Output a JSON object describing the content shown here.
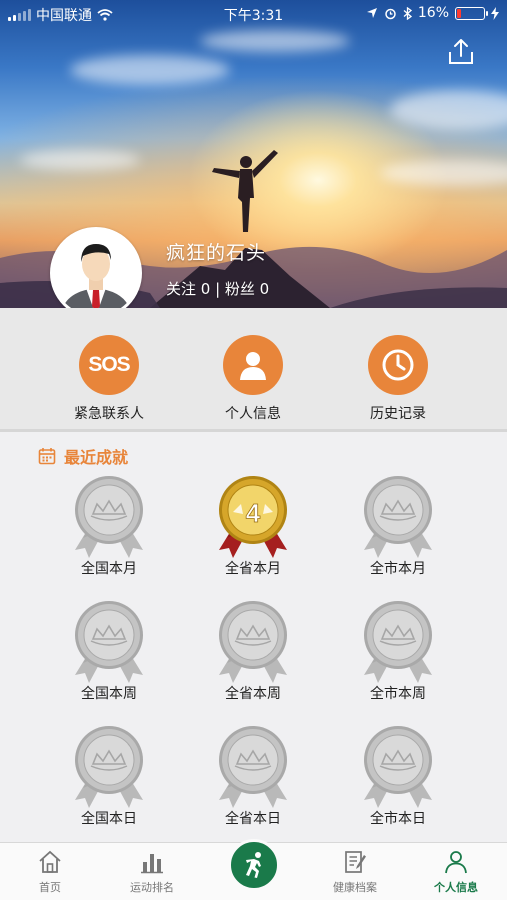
{
  "status_bar": {
    "carrier": "中国联通",
    "time": "下午3:31",
    "battery": "16%",
    "battery_level": 0.16
  },
  "profile": {
    "username": "疯狂的石头",
    "stats": "关注 0 | 粉丝 0"
  },
  "actions": [
    {
      "label": "紧急联系人",
      "icon": "sos-icon",
      "badge": "SOS"
    },
    {
      "label": "个人信息",
      "icon": "person-icon"
    },
    {
      "label": "历史记录",
      "icon": "clock-icon"
    }
  ],
  "achievements": {
    "title": "最近成就",
    "medals": [
      {
        "label": "全国本月",
        "kind": "silver"
      },
      {
        "label": "全省本月",
        "kind": "gold",
        "number": "4"
      },
      {
        "label": "全市本月",
        "kind": "silver"
      },
      {
        "label": "全国本周",
        "kind": "silver"
      },
      {
        "label": "全省本周",
        "kind": "silver"
      },
      {
        "label": "全市本周",
        "kind": "silver"
      },
      {
        "label": "全国本日",
        "kind": "silver"
      },
      {
        "label": "全省本日",
        "kind": "silver"
      },
      {
        "label": "全市本日",
        "kind": "silver"
      }
    ]
  },
  "tabbar": {
    "items": [
      {
        "label": "首页",
        "icon": "home-icon"
      },
      {
        "label": "运动排名",
        "icon": "bar-chart-icon"
      },
      {
        "label": "",
        "icon": "runner-icon"
      },
      {
        "label": "健康档案",
        "icon": "document-icon"
      },
      {
        "label": "个人信息",
        "icon": "person-outline-icon",
        "active": true
      }
    ]
  },
  "colors": {
    "accent_orange": "#e8853a",
    "tab_active_green": "#1a7a4a",
    "gold": "#d6a62a",
    "silver": "#c4c4c4",
    "ribbon_red": "#a51f1f"
  }
}
